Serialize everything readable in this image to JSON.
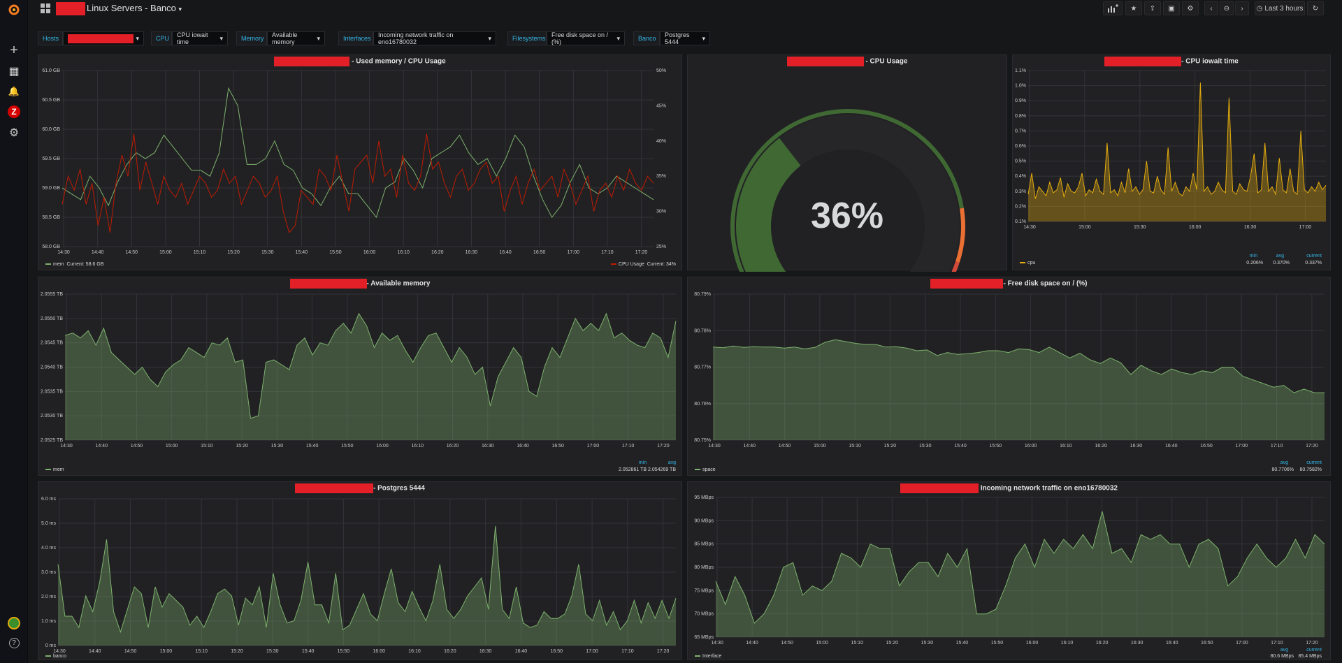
{
  "app": {
    "logo_icon": "grafana-logo-icon"
  },
  "sidemenu": {
    "items": [
      {
        "name": "plus-icon",
        "glyph": "+"
      },
      {
        "name": "dashboards-icon",
        "glyph": "▦"
      },
      {
        "name": "bell-icon",
        "glyph": "🔔"
      },
      {
        "name": "zabbix-icon",
        "glyph": "Z"
      },
      {
        "name": "gear-icon",
        "glyph": "⚙"
      }
    ],
    "help_glyph": "?"
  },
  "header": {
    "title": "Linux Servers - Banco",
    "time_range": "Last 3 hours"
  },
  "variables": [
    {
      "label": "Hosts",
      "value": ""
    },
    {
      "label": "CPU",
      "value": "CPU iowait time"
    },
    {
      "label": "Memory",
      "value": "Available memory"
    },
    {
      "label": "Interfaces",
      "value": "Incoming network traffic on eno16780032"
    },
    {
      "label": "Filesystems",
      "value": "Free disk space on / (%)"
    },
    {
      "label": "Banco",
      "value": "Postgres 5444"
    }
  ],
  "colors": {
    "green": "#7eb26d",
    "red": "#bf1b00",
    "yellow": "#e5ac0e",
    "blue_label": "#33b5e5",
    "panel_bg": "#212124"
  },
  "panels": {
    "mem_cpu": {
      "title": "- Used memory / CPU Usage",
      "legend_left": "mem",
      "legend_left_value": "Current: 58.6 GB",
      "legend_right": "CPU Usage",
      "legend_right_value": "Current: 34%"
    },
    "cpu_gauge": {
      "title": "- CPU Usage",
      "value": "36%",
      "fraction": 0.36
    },
    "iowait": {
      "title": "- CPU iowait time",
      "legend": "cpu",
      "headers": [
        "min",
        "avg",
        "current"
      ],
      "values": [
        "0.206%",
        "0.370%",
        "0.337%"
      ]
    },
    "avail_mem": {
      "title": "- Available memory",
      "legend": "mem",
      "headers": [
        "min",
        "avg"
      ],
      "values": [
        "2.052861 TB",
        "2.054269 TB"
      ]
    },
    "disk": {
      "title": "- Free disk space on / (%)",
      "legend": "space",
      "headers": [
        "avg",
        "current"
      ],
      "values": [
        "80.7706%",
        "80.7582%"
      ]
    },
    "postgres": {
      "title": "- Postgres 5444",
      "legend": "banco"
    },
    "network": {
      "title": "Incoming network traffic on eno16780032",
      "legend": "Interface",
      "headers": [
        "avg",
        "current"
      ],
      "values": [
        "80.6 MBps",
        "85.4 MBps"
      ]
    }
  },
  "chart_data": [
    {
      "id": "mem_cpu",
      "type": "line",
      "x": [
        "14:30",
        "14:40",
        "14:50",
        "15:00",
        "15:10",
        "15:20",
        "15:30",
        "15:40",
        "15:50",
        "16:00",
        "16:10",
        "16:20",
        "16:30",
        "16:40",
        "16:50",
        "17:00",
        "17:10",
        "17:20"
      ],
      "yticks_left": [
        "61.0 GB",
        "60.5 GB",
        "60.0 GB",
        "59.5 GB",
        "59.0 GB",
        "58.5 GB",
        "58.0 GB"
      ],
      "yticks_right": [
        "50%",
        "45%",
        "40%",
        "35%",
        "30%",
        "25%"
      ],
      "ylim_left": [
        58.0,
        61.0
      ],
      "ylim_right": [
        25,
        50
      ],
      "series": [
        {
          "name": "mem",
          "axis": "left",
          "color": "#7eb26d",
          "values": [
            59.0,
            58.9,
            58.8,
            59.2,
            59.0,
            58.7,
            59.1,
            59.4,
            59.6,
            59.5,
            59.6,
            59.9,
            59.7,
            59.5,
            59.3,
            59.3,
            59.2,
            59.6,
            60.7,
            60.4,
            59.4,
            59.4,
            59.5,
            59.8,
            59.4,
            59.3,
            59.0,
            58.9,
            58.7,
            59.0,
            59.2,
            58.9,
            58.9,
            58.7,
            58.5,
            59.0,
            59.1,
            59.5,
            59.3,
            59.0,
            59.5,
            59.6,
            59.7,
            59.9,
            59.6,
            59.4,
            59.5,
            59.2,
            59.5,
            59.9,
            59.7,
            59.2,
            58.8,
            58.5,
            58.7,
            59.1,
            59.4,
            59.0,
            58.9,
            59.0,
            59.2,
            59.1,
            59.0,
            58.9,
            58.8
          ]
        },
        {
          "name": "CPU Usage",
          "axis": "right",
          "color": "#bf1b00",
          "values": [
            31,
            35,
            33,
            36,
            31,
            34,
            28,
            32,
            27,
            34,
            38,
            35,
            41,
            33,
            37,
            34,
            31,
            35,
            33,
            32,
            34,
            31,
            33,
            35,
            34,
            32,
            33,
            36,
            34,
            35,
            31,
            33,
            35,
            34,
            32,
            33,
            35,
            30,
            27,
            28,
            33,
            32,
            31,
            36,
            35,
            33,
            38,
            34,
            30,
            36,
            37,
            38,
            34,
            40,
            35,
            36,
            32,
            38,
            34,
            33,
            35,
            41,
            36,
            37,
            34,
            32,
            35,
            36,
            33,
            34,
            36,
            37,
            34,
            35,
            30,
            33,
            35,
            31,
            34,
            36,
            33,
            34,
            35,
            32,
            36,
            34,
            31,
            33,
            35,
            30,
            33,
            34,
            32,
            35,
            33,
            36,
            34,
            33,
            35,
            34
          ]
        }
      ]
    },
    {
      "id": "iowait",
      "type": "area",
      "x": [
        "14:30",
        "15:00",
        "15:30",
        "16:00",
        "16:30",
        "17:00"
      ],
      "yticks": [
        "1.1%",
        "1.0%",
        "0.9%",
        "0.8%",
        "0.7%",
        "0.6%",
        "0.5%",
        "0.4%",
        "0.3%",
        "0.2%",
        "0.1%"
      ],
      "ylim": [
        0.1,
        1.1
      ],
      "series": [
        {
          "name": "cpu",
          "color": "#e5ac0e",
          "values": [
            0.28,
            0.42,
            0.25,
            0.33,
            0.3,
            0.27,
            0.36,
            0.29,
            0.31,
            0.39,
            0.26,
            0.35,
            0.3,
            0.29,
            0.33,
            0.42,
            0.27,
            0.31,
            0.29,
            0.38,
            0.3,
            0.28,
            0.62,
            0.29,
            0.31,
            0.27,
            0.36,
            0.29,
            0.45,
            0.3,
            0.33,
            0.28,
            0.31,
            0.5,
            0.3,
            0.29,
            0.4,
            0.31,
            0.28,
            0.59,
            0.3,
            0.36,
            0.29,
            0.27,
            0.33,
            0.3,
            0.42,
            0.31,
            1.02,
            0.3,
            0.33,
            0.28,
            0.3,
            0.36,
            0.31,
            0.29,
            0.92,
            0.3,
            0.28,
            0.35,
            0.31,
            0.3,
            0.4,
            0.55,
            0.29,
            0.31,
            0.62,
            0.3,
            0.33,
            0.28,
            0.52,
            0.31,
            0.29,
            0.45,
            0.3,
            0.28,
            0.7,
            0.31,
            0.29,
            0.33,
            0.3,
            0.36,
            0.31,
            0.34
          ]
        }
      ]
    },
    {
      "id": "avail_mem",
      "type": "area",
      "x": [
        "14:30",
        "14:40",
        "14:50",
        "15:00",
        "15:10",
        "15:20",
        "15:30",
        "15:40",
        "15:50",
        "16:00",
        "16:10",
        "16:20",
        "16:30",
        "16:40",
        "16:50",
        "17:00",
        "17:10",
        "17:20"
      ],
      "yticks": [
        "2.0555 TB",
        "2.0550 TB",
        "2.0545 TB",
        "2.0540 TB",
        "2.0535 TB",
        "2.0530 TB",
        "2.0525 TB"
      ],
      "ylim": [
        2.0525,
        2.0555
      ],
      "series": [
        {
          "name": "mem",
          "color": "#7eb26d",
          "values": [
            2.05465,
            2.0547,
            2.0546,
            2.05475,
            2.05445,
            2.0548,
            2.0543,
            2.05415,
            2.054,
            2.05385,
            2.054,
            2.05375,
            2.0536,
            2.0539,
            2.05405,
            2.05415,
            2.0544,
            2.0543,
            2.0542,
            2.0545,
            2.05445,
            2.0546,
            2.0541,
            2.05415,
            2.05295,
            2.053,
            2.0541,
            2.05415,
            2.05405,
            2.05395,
            2.05445,
            2.0546,
            2.05425,
            2.0545,
            2.05445,
            2.05475,
            2.0549,
            2.0547,
            2.0551,
            2.05485,
            2.0544,
            2.0547,
            2.05455,
            2.05465,
            2.05435,
            2.0541,
            2.0544,
            2.05465,
            2.0547,
            2.0544,
            2.0541,
            2.0544,
            2.0542,
            2.05385,
            2.054,
            2.0532,
            2.0538,
            2.0541,
            2.0544,
            2.0542,
            2.0535,
            2.0534,
            2.054,
            2.0544,
            2.0542,
            2.0546,
            2.055,
            2.05475,
            2.0549,
            2.05475,
            2.0551,
            2.0546,
            2.0547,
            2.05455,
            2.05445,
            2.0544,
            2.0547,
            2.0546,
            2.0542,
            2.05495
          ]
        }
      ]
    },
    {
      "id": "disk",
      "type": "area",
      "x": [
        "14:30",
        "14:40",
        "14:50",
        "15:00",
        "15:10",
        "15:20",
        "15:30",
        "15:40",
        "15:50",
        "16:00",
        "16:10",
        "16:20",
        "16:30",
        "16:40",
        "16:50",
        "17:00",
        "17:10",
        "17:20"
      ],
      "yticks": [
        "80.79%",
        "80.78%",
        "80.77%",
        "80.76%",
        "80.75%"
      ],
      "ylim": [
        80.75,
        80.79
      ],
      "series": [
        {
          "name": "space",
          "color": "#7eb26d",
          "values": [
            80.7755,
            80.7753,
            80.7758,
            80.7754,
            80.7756,
            80.7755,
            80.7755,
            80.7752,
            80.7755,
            80.775,
            80.7754,
            80.7768,
            80.7775,
            80.777,
            80.7765,
            80.7762,
            80.7762,
            80.7755,
            80.7756,
            80.7752,
            80.7745,
            80.7747,
            80.7732,
            80.774,
            80.7735,
            80.7737,
            80.774,
            80.7745,
            80.7745,
            80.774,
            80.775,
            80.7748,
            80.774,
            80.7755,
            80.774,
            80.7725,
            80.7738,
            80.772,
            80.771,
            80.7725,
            80.7712,
            80.768,
            80.7705,
            80.769,
            80.768,
            80.7695,
            80.7685,
            80.768,
            80.769,
            80.7685,
            80.77,
            80.77,
            80.7675,
            80.7665,
            80.7655,
            80.7645,
            80.765,
            80.763,
            80.764,
            80.763,
            80.763
          ]
        }
      ]
    },
    {
      "id": "postgres",
      "type": "area",
      "x": [
        "14:30",
        "14:40",
        "14:50",
        "15:00",
        "15:10",
        "15:20",
        "15:30",
        "15:40",
        "15:50",
        "16:00",
        "16:10",
        "16:20",
        "16:30",
        "16:40",
        "16:50",
        "17:00",
        "17:10",
        "17:20"
      ],
      "yticks": [
        "6.0 ms",
        "5.0 ms",
        "4.0 ms",
        "3.0 ms",
        "2.0 ms",
        "1.0 ms",
        "0 ms"
      ],
      "ylim": [
        0,
        6.5
      ],
      "series": [
        {
          "name": "banco",
          "color": "#7eb26d",
          "values": [
            3.6,
            1.3,
            1.3,
            0.8,
            2.2,
            1.5,
            2.8,
            4.7,
            1.5,
            0.6,
            1.6,
            2.6,
            2.3,
            0.8,
            2.6,
            1.7,
            2.3,
            2.0,
            1.7,
            0.9,
            1.3,
            0.8,
            1.5,
            2.3,
            2.5,
            2.2,
            0.9,
            2.1,
            1.8,
            2.6,
            0.8,
            3.2,
            1.8,
            1.0,
            1.1,
            2.0,
            3.7,
            1.8,
            1.8,
            1.0,
            3.2,
            0.7,
            0.9,
            1.6,
            2.3,
            1.4,
            1.1,
            2.3,
            3.4,
            1.9,
            1.5,
            2.4,
            1.7,
            1.1,
            2.0,
            3.6,
            1.6,
            1.2,
            1.6,
            2.2,
            2.6,
            3.0,
            1.6,
            5.3,
            1.6,
            1.2,
            2.6,
            1.0,
            0.8,
            0.9,
            1.5,
            1.2,
            1.2,
            1.4,
            2.2,
            3.6,
            1.4,
            1.1,
            2.0,
            0.9,
            1.5,
            0.7,
            1.1,
            2.0,
            1.0,
            1.9,
            1.2,
            2.0,
            1.2,
            2.1
          ]
        }
      ]
    },
    {
      "id": "network",
      "type": "area",
      "x": [
        "14:30",
        "14:40",
        "14:50",
        "15:00",
        "15:10",
        "15:20",
        "15:30",
        "15:40",
        "15:50",
        "16:00",
        "16:10",
        "16:20",
        "16:30",
        "16:40",
        "16:50",
        "17:00",
        "17:10",
        "17:20"
      ],
      "yticks": [
        "95 MBps",
        "90 MBps",
        "85 MBps",
        "80 MBps",
        "75 MBps",
        "70 MBps",
        "65 MBps"
      ],
      "ylim": [
        65,
        95
      ],
      "series": [
        {
          "name": "Interface",
          "color": "#7eb26d",
          "values": [
            77,
            72,
            78,
            74,
            68,
            70,
            74,
            80,
            81,
            74,
            76,
            75,
            77,
            83,
            82,
            80,
            85,
            84,
            84,
            76,
            79,
            81,
            81,
            78,
            83,
            80,
            84,
            70,
            70,
            71,
            76,
            82,
            85,
            80,
            86,
            83,
            86,
            84,
            87,
            84,
            92,
            83,
            84,
            81,
            87,
            86,
            87,
            85,
            85,
            80,
            85,
            86,
            84,
            76,
            78,
            82,
            85,
            82,
            80,
            82,
            86,
            82,
            87,
            85
          ]
        }
      ]
    }
  ]
}
